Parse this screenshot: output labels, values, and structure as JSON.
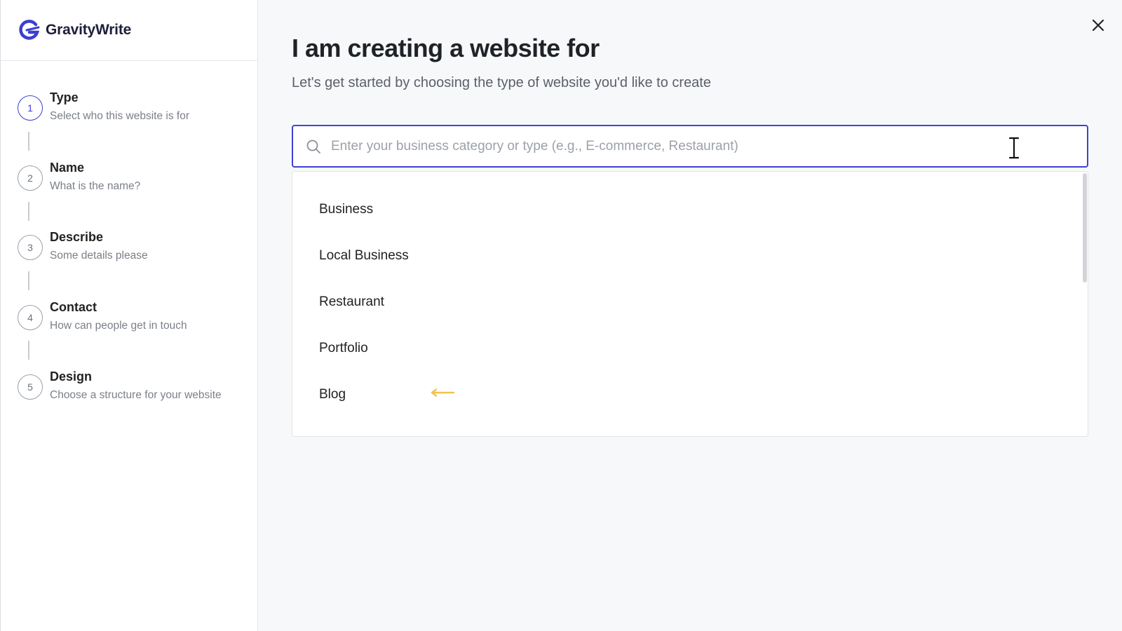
{
  "brand": {
    "name": "GravityWrite",
    "accent": "#3b3fd0"
  },
  "steps": [
    {
      "number": "1",
      "title": "Type",
      "subtitle": "Select who this website is for",
      "active": true
    },
    {
      "number": "2",
      "title": "Name",
      "subtitle": "What is the name?",
      "active": false
    },
    {
      "number": "3",
      "title": "Describe",
      "subtitle": "Some details please",
      "active": false
    },
    {
      "number": "4",
      "title": "Contact",
      "subtitle": "How can people get in touch",
      "active": false
    },
    {
      "number": "5",
      "title": "Design",
      "subtitle": "Choose a structure for your website",
      "active": false
    }
  ],
  "main": {
    "heading": "I am creating a website for",
    "subheading": "Let's get started by choosing the type of website you'd like to create",
    "search": {
      "placeholder": "Enter your business category or type (e.g., E-commerce, Restaurant)",
      "value": ""
    },
    "options": [
      "Business",
      "Local Business",
      "Restaurant",
      "Portfolio",
      "Blog"
    ],
    "highlight_arrow_color": "#f2c14e"
  },
  "icons": {
    "close": "close-icon",
    "search": "search-icon",
    "logo": "gravitywrite-logo-icon",
    "arrow": "arrow-left-icon"
  }
}
